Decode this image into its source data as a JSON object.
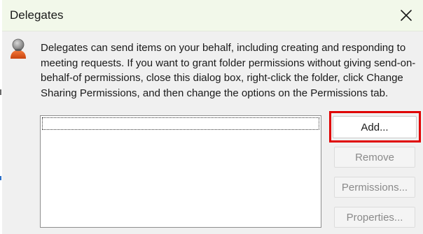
{
  "dialog": {
    "title": "Delegates",
    "close_icon": "close-icon",
    "user_icon": "delegate-user-icon"
  },
  "main": {
    "description": "Delegates can send items on your behalf, including creating and responding to meeting requests. If you want to grant folder permissions without giving send-on-behalf-of permissions, close this dialog box, right-click the folder, click Change Sharing Permissions, and then change the options on the Permissions tab.",
    "delegates": []
  },
  "buttons": {
    "add": "Add...",
    "remove": "Remove",
    "permissions": "Permissions...",
    "properties": "Properties..."
  },
  "colors": {
    "titlebar": "#f2f8ea",
    "dialog_background": "#f0f0f0",
    "highlight": "#e00000",
    "disabled_text": "#8a8a8a",
    "icon_person_head": "#8c8c8c",
    "icon_person_body": "#e8581c"
  }
}
